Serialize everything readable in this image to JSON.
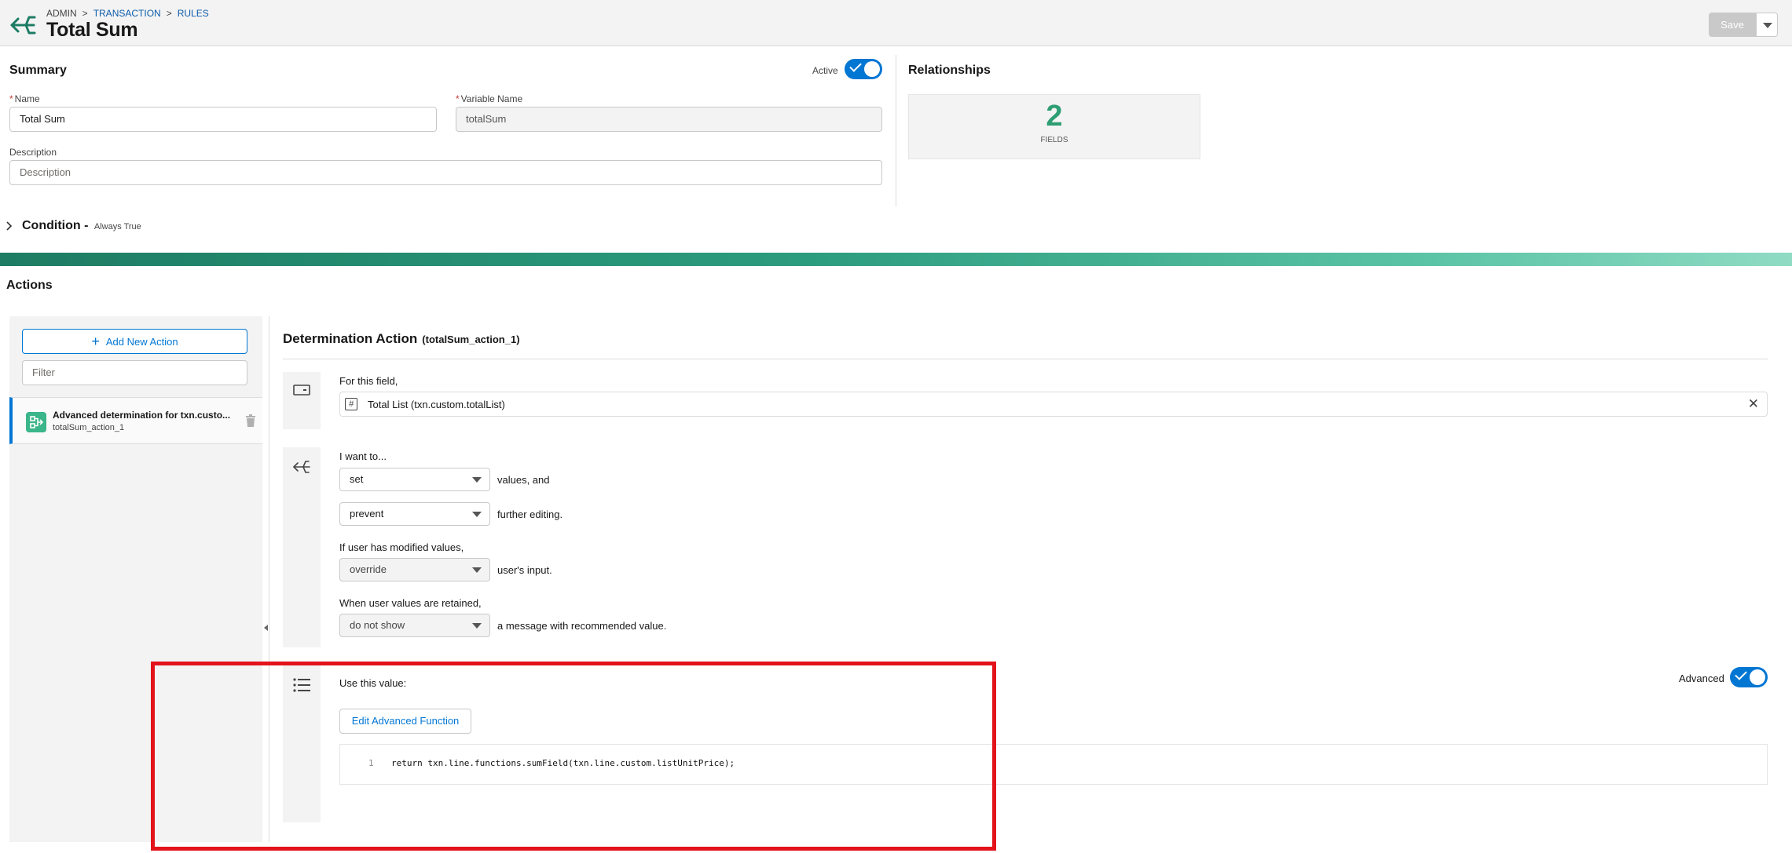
{
  "header": {
    "breadcrumb": [
      "ADMIN",
      "TRANSACTION",
      "RULES"
    ],
    "breadcrumb_sep": ">",
    "title": "Total Sum",
    "save_label": "Save"
  },
  "summary": {
    "title": "Summary",
    "active_label": "Active",
    "active": true,
    "name_label": "Name",
    "name_value": "Total Sum",
    "variable_label": "Variable Name",
    "variable_value": "totalSum",
    "description_label": "Description",
    "description_placeholder": "Description",
    "condition_label": "Condition -",
    "condition_value": "Always True"
  },
  "relationships": {
    "title": "Relationships",
    "count": "2",
    "count_label": "FIELDS"
  },
  "actions": {
    "title": "Actions",
    "add_label": "Add New Action",
    "filter_placeholder": "Filter",
    "items": [
      {
        "title": "Advanced determination for txn.custo...",
        "subtitle": "totalSum_action_1"
      }
    ]
  },
  "determination": {
    "title": "Determination Action",
    "id": "(totalSum_action_1)",
    "for_field_label": "For this field,",
    "field_value": "Total List (txn.custom.totalList)",
    "want_label": "I want to...",
    "set_value": "set",
    "set_suffix": "values, and",
    "prevent_value": "prevent",
    "prevent_suffix": "further editing.",
    "modified_label": "If user has modified values,",
    "override_value": "override",
    "override_suffix": "user's input.",
    "retained_label": "When user values are retained,",
    "show_value": "do not show",
    "show_suffix": "a message with recommended value.",
    "use_value_label": "Use this value:",
    "advanced_label": "Advanced",
    "advanced": true,
    "edit_function_label": "Edit Advanced Function",
    "code": {
      "line_number": "1",
      "text": "return txn.line.functions.sumField(txn.line.custom.listUnitPrice);"
    }
  },
  "colors": {
    "accent": "#0176d3",
    "brand_green": "#2e9e74",
    "highlight": "#e3131b"
  }
}
